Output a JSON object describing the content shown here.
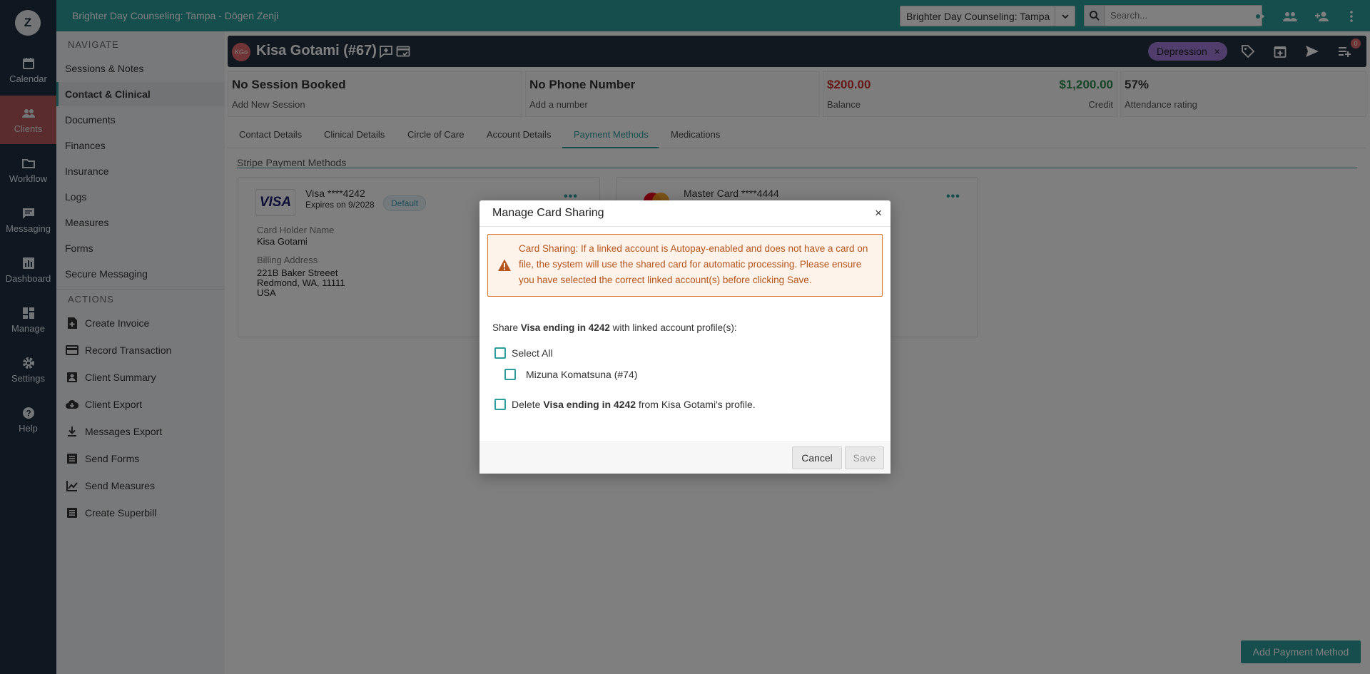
{
  "rail": {
    "logo": "Z",
    "items": [
      {
        "label": "Calendar",
        "icon": "calendar-icon"
      },
      {
        "label": "Clients",
        "icon": "clients-icon"
      },
      {
        "label": "Workflow",
        "icon": "folder-icon"
      },
      {
        "label": "Messaging",
        "icon": "message-icon"
      },
      {
        "label": "Dashboard",
        "icon": "chart-icon"
      },
      {
        "label": "Manage",
        "icon": "grid-icon"
      },
      {
        "label": "Settings",
        "icon": "gear-icon"
      },
      {
        "label": "Help",
        "icon": "help-icon"
      }
    ]
  },
  "topbar": {
    "title": "Brighter Day Counseling: Tampa - Dōgen Zenji",
    "location": "Brighter Day Counseling: Tampa",
    "search_placeholder": "Search..."
  },
  "sidenav": {
    "navigate_heading": "NAVIGATE",
    "navigate": [
      "Sessions & Notes",
      "Contact & Clinical",
      "Documents",
      "Finances",
      "Insurance",
      "Logs",
      "Measures",
      "Forms",
      "Secure Messaging"
    ],
    "actions_heading": "ACTIONS",
    "actions": [
      "Create Invoice",
      "Record Transaction",
      "Client Summary",
      "Client Export",
      "Messages Export",
      "Send Forms",
      "Send Measures",
      "Create Superbill"
    ]
  },
  "client": {
    "initials": "KGo",
    "name": "Kisa Gotami (#67)",
    "tag": "Depression",
    "tag_remove": "×",
    "notification_count": "0"
  },
  "stats": {
    "session": {
      "main": "No Session Booked",
      "sub": "Add New Session"
    },
    "phone": {
      "main": "No Phone Number",
      "sub": "Add a number"
    },
    "balance": {
      "main": "$200.00",
      "sub": "Balance",
      "credit_main": "$1,200.00",
      "credit_sub": "Credit"
    },
    "attendance": {
      "main": "57%",
      "sub": "Attendance rating"
    }
  },
  "tabs": [
    "Contact Details",
    "Clinical Details",
    "Circle of Care",
    "Account Details",
    "Payment Methods",
    "Medications"
  ],
  "payment": {
    "section_title": "Stripe Payment Methods",
    "visa": {
      "logo": "VISA",
      "name": "Visa ****4242",
      "expires": "Expires on 9/2028",
      "badge": "Default",
      "holder_label": "Card Holder Name",
      "holder": "Kisa Gotami",
      "address_label": "Billing Address",
      "address1": "221B Baker Streeet",
      "address2": "Redmond, WA, 11111",
      "address3": "USA"
    },
    "mastercard": {
      "name": "Master Card ****4444"
    },
    "more": "•••",
    "add_button": "Add Payment Method"
  },
  "modal": {
    "title": "Manage Card Sharing",
    "close": "×",
    "alert": "Card Sharing: If a linked account is Autopay-enabled and does not have a card on file, the system will use the shared card for automatic processing. Please ensure you have selected the correct linked account(s) before clicking Save.",
    "share_prefix": "Share ",
    "card_bold": "Visa ending in 4242",
    "share_suffix": " with linked account profile(s):",
    "select_all": "Select All",
    "linked_profile": "Mizuna Komatsuna (#74)",
    "delete_prefix": "Delete ",
    "delete_suffix": " from Kisa Gotami's profile.",
    "cancel": "Cancel",
    "save": "Save"
  },
  "colors": {
    "teal": "#2d9c9d",
    "navy": "#1f3141",
    "header": "#233140",
    "danger": "#d03030",
    "success": "#2b8a4e",
    "tag": "#a17ad8",
    "warning": "#d8732a"
  }
}
